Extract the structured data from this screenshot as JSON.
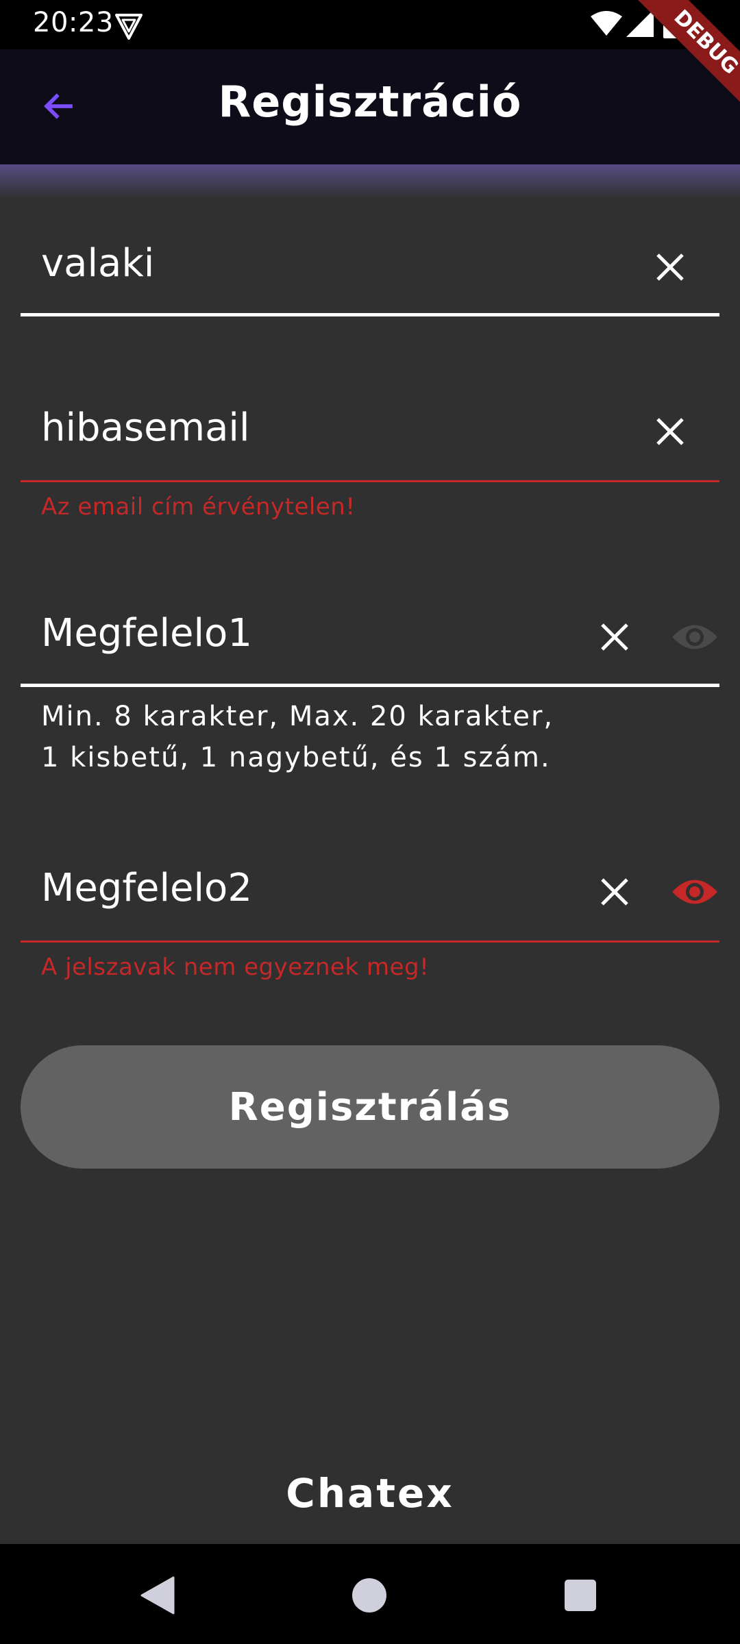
{
  "status_bar": {
    "time": "20:23",
    "icons": [
      "vpn-icon",
      "wifi-icon",
      "signal-icon",
      "battery-icon"
    ]
  },
  "debug_banner": "DEBUG",
  "app_bar": {
    "title": "Regisztráció",
    "back_icon": "arrow-back-icon",
    "accent_color": "#7c4dff"
  },
  "form": {
    "username": {
      "value": "valaki",
      "clear_icon": "close-icon"
    },
    "email": {
      "value": "hibasemail",
      "error": "Az email cím érvénytelen!",
      "clear_icon": "close-icon"
    },
    "password": {
      "value": "Megfelelo1",
      "helper_line1": "Min. 8 karakter, Max. 20 karakter,",
      "helper_line2": "1 kisbetű, 1 nagybetű, és 1 szám.",
      "clear_icon": "close-icon",
      "visibility_icon": "eye-icon"
    },
    "password_confirm": {
      "value": "Megfelelo2",
      "error": "A jelszavak nem egyeznek meg!",
      "clear_icon": "close-icon",
      "visibility_icon": "eye-icon"
    },
    "submit_label": "Regisztrálás"
  },
  "footer": {
    "brand": "Chatex"
  },
  "colors": {
    "background": "#303030",
    "app_bar": "#0e0c18",
    "error": "#c62828",
    "button": "#626262"
  },
  "nav_bar": {
    "icons": [
      "back-triangle-icon",
      "home-circle-icon",
      "recents-square-icon"
    ]
  }
}
